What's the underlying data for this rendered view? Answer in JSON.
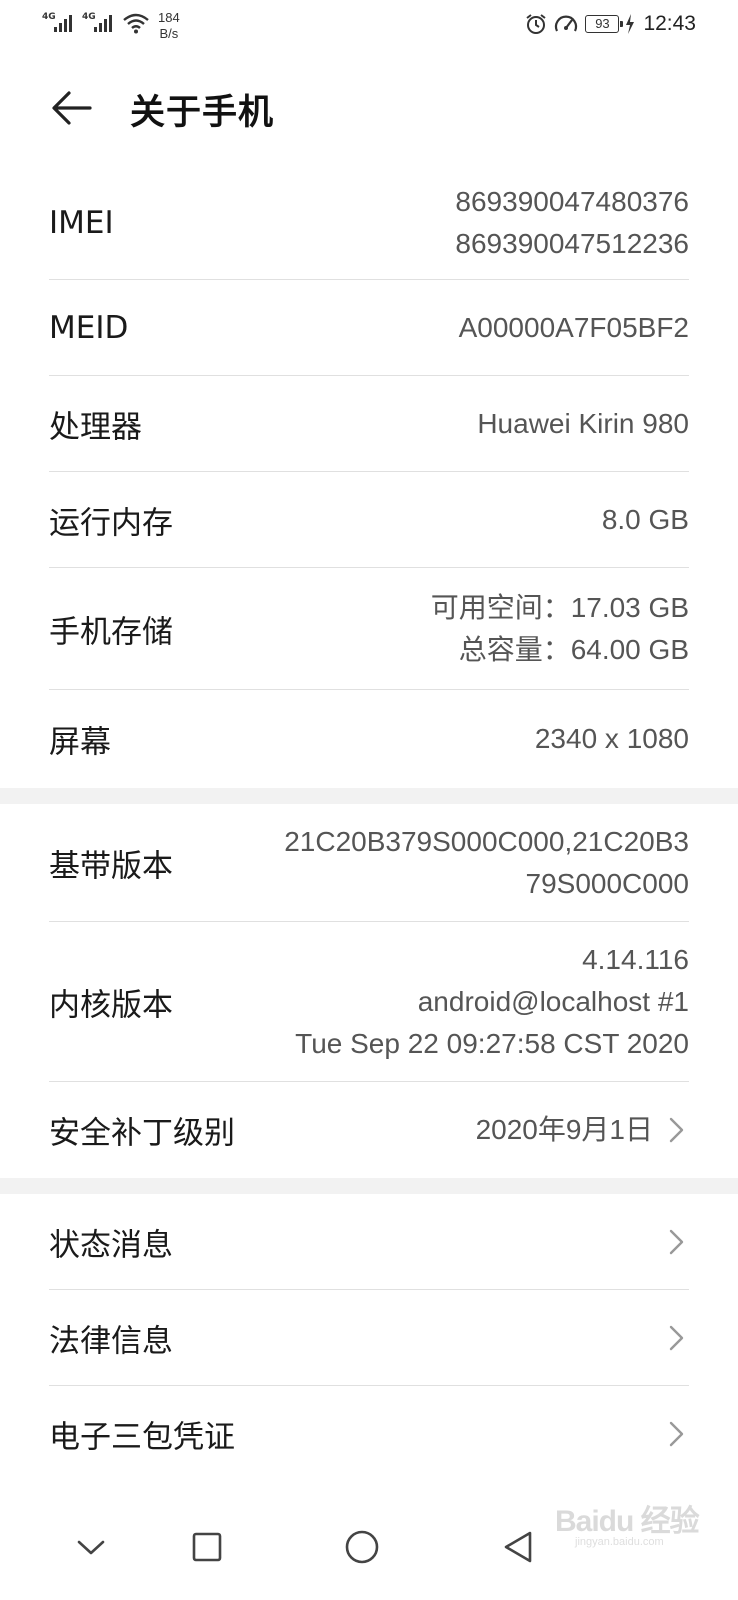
{
  "status_bar": {
    "signal1_label": "4G",
    "signal2_label": "4G",
    "speed_value": "184",
    "speed_unit": "B/s",
    "battery": "93",
    "time": "12:43",
    "icons": [
      "signal-icon",
      "wifi-icon",
      "alarm-icon",
      "speedometer-icon",
      "battery-icon",
      "charging-icon"
    ]
  },
  "header": {
    "title": "关于手机",
    "back_icon": "back-arrow-icon"
  },
  "info_rows": [
    {
      "label": "IMEI",
      "value_lines": [
        "869390047480376",
        "869390047512236"
      ]
    },
    {
      "label": "MEID",
      "value_lines": [
        "A00000A7F05BF2"
      ]
    },
    {
      "label": "处理器",
      "value_lines": [
        "Huawei Kirin 980"
      ]
    },
    {
      "label": "运行内存",
      "value_lines": [
        "8.0 GB"
      ]
    },
    {
      "label": "手机存储",
      "value_lines": [
        "可用空间：17.03  GB",
        "总容量：64.00  GB"
      ]
    },
    {
      "label": "屏幕",
      "value_lines": [
        "2340 x 1080"
      ]
    }
  ],
  "version_rows": [
    {
      "label": "基带版本",
      "value_lines": [
        "21C20B379S000C000,21C20B3",
        "79S000C000"
      ]
    },
    {
      "label": "内核版本",
      "value_lines": [
        "4.14.116",
        "android@localhost #1",
        "Tue Sep 22 09:27:58 CST 2020"
      ]
    },
    {
      "label": "安全补丁级别",
      "value_lines": [
        "2020年9月1日"
      ]
    }
  ],
  "link_rows": [
    {
      "label": "状态消息"
    },
    {
      "label": "法律信息"
    },
    {
      "label": "电子三包凭证"
    }
  ],
  "nav_bar": {
    "icons": [
      "collapse-down-icon",
      "recents-square-icon",
      "home-circle-icon",
      "back-triangle-icon"
    ]
  },
  "watermark": {
    "main": "Baidu 经验",
    "sub": "jingyan.baidu.com"
  },
  "colors": {
    "background": "#ffffff",
    "divider": "#e0e0e0",
    "section_gap": "#f2f2f2",
    "primary_text": "#1a1a1a",
    "secondary_text": "#555555"
  }
}
